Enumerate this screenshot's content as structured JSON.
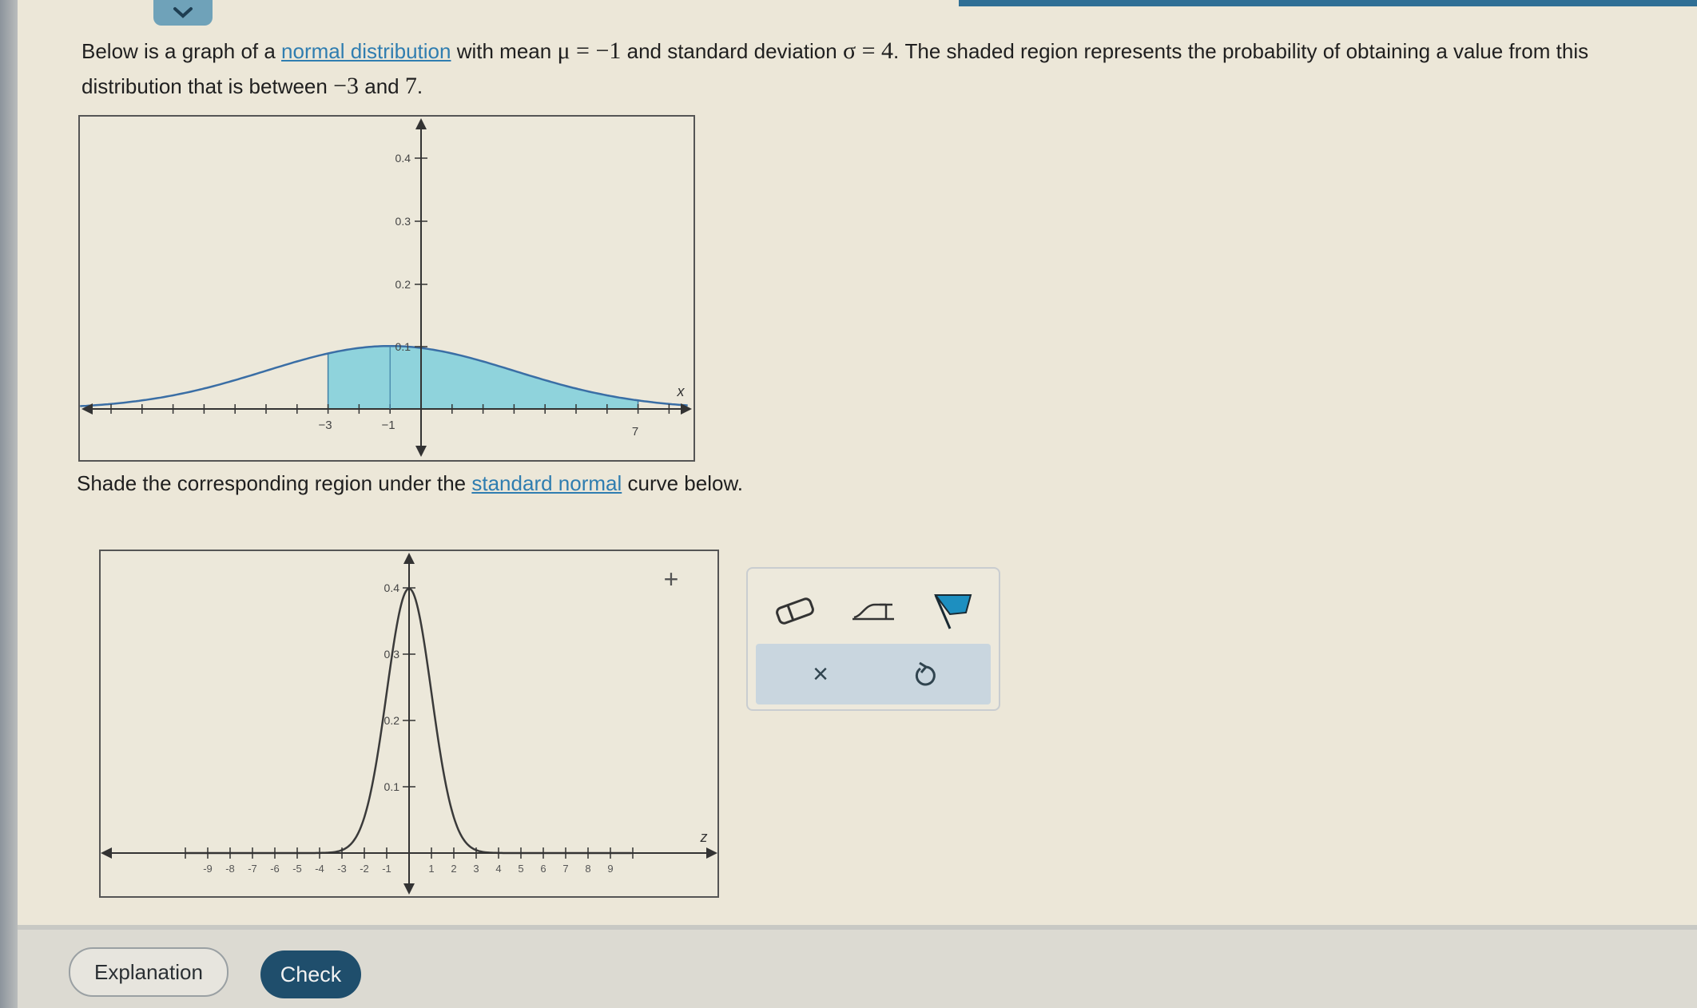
{
  "question": {
    "intro": "Below is a graph of a",
    "link_normal": "normal distribution",
    "with_mean": "with mean",
    "mu_expr": "μ = −1",
    "and_sd": "and standard deviation",
    "sigma_expr": "σ = 4",
    "sentence_rest": ". The shaded region represents the probability of obtaining a value from this distribution that is between",
    "lower": "−3",
    "and_word": "and",
    "upper": "7",
    "end": "."
  },
  "instruction": {
    "before": "Shade the corresponding region under the",
    "link": "standard normal",
    "after": "curve below."
  },
  "graph1": {
    "y_ticks": [
      "0.4",
      "0.3",
      "0.2",
      "0.1"
    ],
    "x_labels": [
      "−3",
      "−1",
      "7"
    ],
    "x_axis_label": "x",
    "mean": -1,
    "sd": 4,
    "shade_from": -3,
    "shade_to": 7,
    "shade_color": "#8fd3dc"
  },
  "graph2": {
    "y_ticks": [
      "0.4",
      "0.3",
      "0.2",
      "0.1"
    ],
    "x_ticks": [
      "-9",
      "-8",
      "-7",
      "-6",
      "-5",
      "-4",
      "-3",
      "-2",
      "-1",
      "1",
      "2",
      "3",
      "4",
      "5",
      "6",
      "7",
      "8",
      "9"
    ],
    "x_axis_label": "z",
    "crosshair": "+"
  },
  "tools": {
    "eraser": "eraser-icon",
    "area": "area-under-curve-icon",
    "flag": "flag-icon",
    "clear": "×",
    "undo": "undo-icon",
    "accent": "#1d8fc0"
  },
  "footer": {
    "explanation": "Explanation",
    "check": "Check"
  }
}
